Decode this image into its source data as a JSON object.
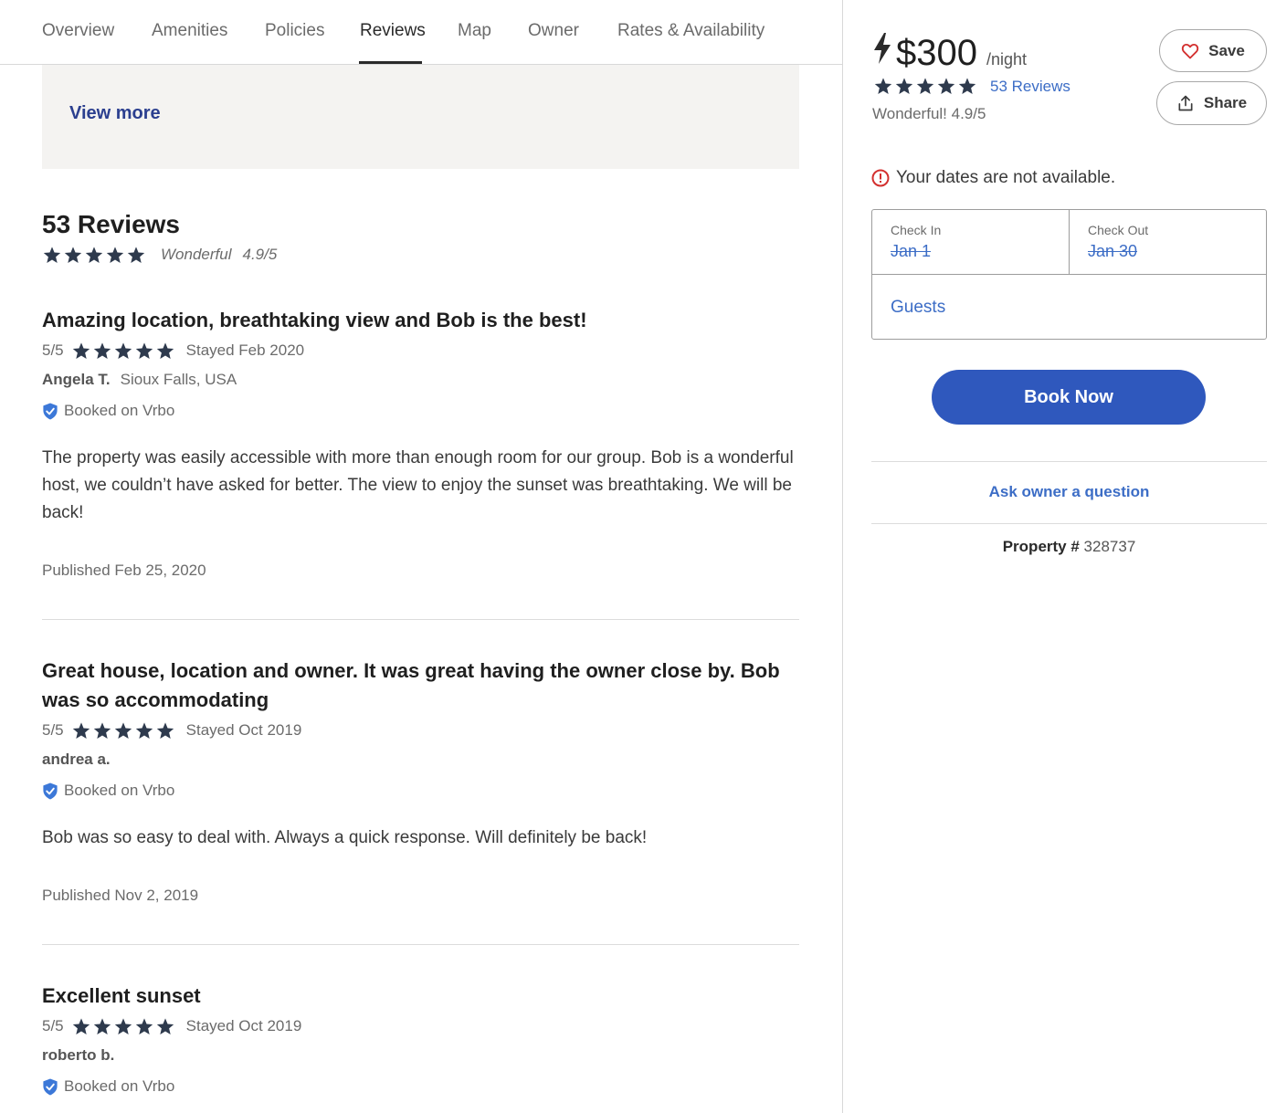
{
  "tabs": [
    {
      "label": "Overview",
      "active": false
    },
    {
      "label": "Amenities",
      "active": false
    },
    {
      "label": "Policies",
      "active": false
    },
    {
      "label": "Reviews",
      "active": true
    },
    {
      "label": "Map",
      "active": false
    },
    {
      "label": "Owner",
      "active": false
    },
    {
      "label": "Rates & Availability",
      "active": false
    }
  ],
  "view_more": {
    "label": "View more"
  },
  "reviews_section": {
    "heading": "53 Reviews",
    "rating_word": "Wonderful",
    "rating_value": "4.9/5",
    "stars": 5
  },
  "reviews": [
    {
      "title": "Amazing location, breathtaking view and Bob is the best!",
      "score": "5/5",
      "stars": 5,
      "stayed": "Stayed Feb 2020",
      "reviewer": "Angela T.",
      "location": "Sioux Falls, USA",
      "booked": "Booked on Vrbo",
      "body": "The property was easily accessible with more than enough room for our group. Bob is a wonderful host, we couldn’t have asked for better. The view to enjoy the sunset was breathtaking. We will be back!",
      "published": "Published Feb 25, 2020"
    },
    {
      "title": "Great house, location and owner. It was great having the owner close by. Bob was so accommodating",
      "score": "5/5",
      "stars": 5,
      "stayed": "Stayed Oct 2019",
      "reviewer": "andrea a.",
      "location": "",
      "booked": "Booked on Vrbo",
      "body": "Bob was so easy to deal with. Always a quick response. Will definitely be back!",
      "published": "Published Nov 2, 2019"
    },
    {
      "title": "Excellent sunset",
      "score": "5/5",
      "stars": 5,
      "stayed": "Stayed Oct 2019",
      "reviewer": "roberto b.",
      "location": "",
      "booked": "Booked on Vrbo"
    }
  ],
  "sidebar": {
    "price": "$300",
    "per_night": "/night",
    "stars": 5,
    "reviews_link": "53 Reviews",
    "rating_text": "Wonderful! 4.9/5",
    "save_label": "Save",
    "share_label": "Share",
    "unavailable_text": "Your dates are not available.",
    "check_in_label": "Check In",
    "check_in_value": "Jan 1",
    "check_out_label": "Check Out",
    "check_out_value": "Jan 30",
    "guests_label": "Guests",
    "book_now_label": "Book Now",
    "ask_owner_label": "Ask owner a question",
    "property_label": "Property #",
    "property_number": "328737"
  },
  "colors": {
    "star": "#2e3a4d",
    "link_blue": "#3c6dc6",
    "book_button": "#2f58bd",
    "view_more": "#2b3f8f",
    "error_red": "#d3302f",
    "heart_red": "#d3302f",
    "shield_blue": "#3c78d8"
  },
  "icons": {
    "bolt": "lightning-bolt-icon",
    "heart": "heart-icon",
    "share": "share-upload-icon",
    "alert": "alert-circle-icon",
    "shield": "verified-shield-icon",
    "star": "star-icon"
  }
}
